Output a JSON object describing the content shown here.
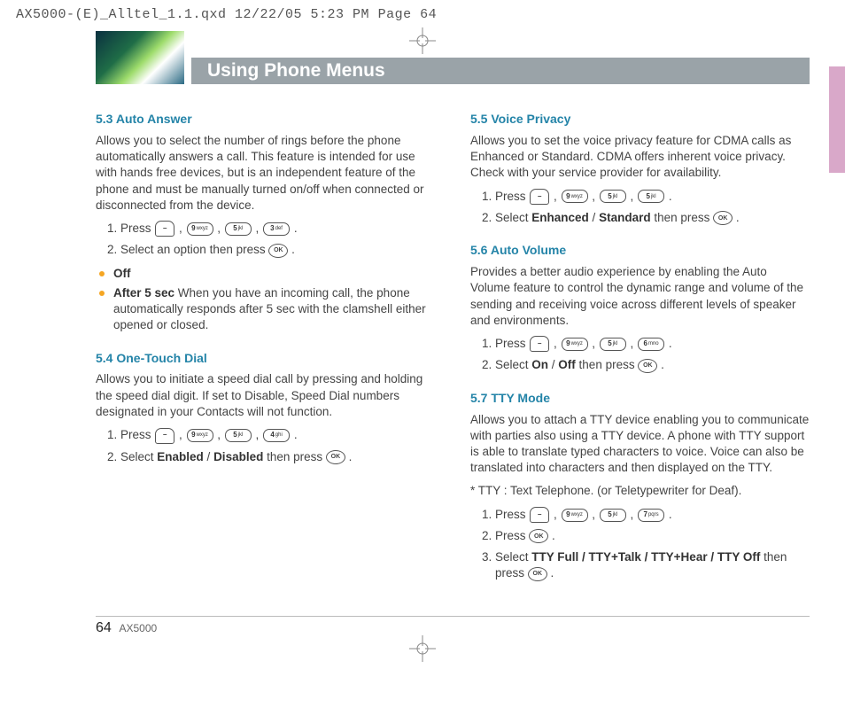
{
  "slug": "AX5000-(E)_Alltel_1.1.qxd  12/22/05  5:23 PM  Page 64",
  "title": "Using Phone Menus",
  "footer": {
    "page": "64",
    "model": "AX5000"
  },
  "keys": {
    "9": "9",
    "9sup": "wxyz",
    "5": "5",
    "5sup": "jkl",
    "3": "3",
    "3sup": "def",
    "4": "4",
    "4sup": "ghi",
    "6": "6",
    "6sup": "mno",
    "7": "7",
    "7sup": "pqrs",
    "ok": "OK"
  },
  "s53": {
    "head": "5.3 Auto Answer",
    "body": "Allows you to select the number of rings before the phone automatically answers a call. This feature is intended for use with hands free devices, but is an independent feature of the phone and must be manually turned on/off when connected or disconnected from the device.",
    "step1a": "Press ",
    "step2a": "Select an option then press ",
    "off": "Off",
    "after5b": "After 5 sec",
    "after5r": " When you have an incoming call, the phone automatically responds after 5 sec with the clamshell either opened or closed."
  },
  "s54": {
    "head": "5.4 One-Touch Dial",
    "body": "Allows you to initiate a speed dial call by pressing and holding the speed dial digit. If set to Disable, Speed Dial numbers designated in your Contacts will not function.",
    "step1a": "Press ",
    "step2a": "Select ",
    "step2b": "Enabled",
    "step2s": " / ",
    "step2c": "Disabled",
    "step2d": " then press "
  },
  "s55": {
    "head": "5.5 Voice Privacy",
    "body": "Allows you to set the voice privacy feature for CDMA calls as Enhanced or Standard. CDMA offers inherent voice privacy. Check with your service provider for availability.",
    "step1a": "Press ",
    "step2a": "Select ",
    "step2b": "Enhanced",
    "step2s": " / ",
    "step2c": "Standard",
    "step2d": " then press "
  },
  "s56": {
    "head": "5.6 Auto Volume",
    "body": "Provides a better audio experience by enabling the Auto Volume feature to control the dynamic range and volume of the sending and receiving voice across different levels of speaker and environments.",
    "step1a": "Press ",
    "step2a": "Select ",
    "step2b": "On",
    "step2s": " / ",
    "step2c": "Off",
    "step2d": " then press "
  },
  "s57": {
    "head": "5.7 TTY Mode",
    "body": "Allows you to attach a TTY device enabling you to communicate with parties also using a TTY device. A phone with TTY support is able to translate typed characters to voice. Voice can also be translated into characters and then displayed on the TTY.",
    "note": "* TTY :  Text Telephone. (or Teletypewriter for Deaf).",
    "step1a": "Press ",
    "step2a": "Press ",
    "step3a": "Select ",
    "step3b": "TTY Full / TTY+Talk / TTY+Hear / TTY Off",
    "step3d": " then press "
  }
}
